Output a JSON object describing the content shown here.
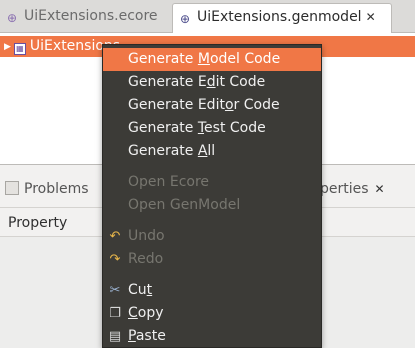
{
  "tabs": [
    {
      "label": "UiExtensions.ecore",
      "icon": "ecore-file-icon",
      "active": false
    },
    {
      "label": "UiExtensions.genmodel",
      "icon": "genmodel-file-icon",
      "active": true,
      "close": "✕"
    }
  ],
  "tree": {
    "root_label": "UiExtensions",
    "expand_glyph": "▶"
  },
  "panel": {
    "problems_label": "Problems",
    "properties_label": "perties",
    "properties_close": "✕",
    "property_column": "Property"
  },
  "menu": {
    "items": [
      {
        "pre": "Generate ",
        "ul": "M",
        "post": "odel Code",
        "enabled": true,
        "selected": true
      },
      {
        "pre": "Generate E",
        "ul": "d",
        "post": "it Code",
        "enabled": true
      },
      {
        "pre": "Generate Edit",
        "ul": "o",
        "post": "r Code",
        "enabled": true
      },
      {
        "pre": "Generate ",
        "ul": "T",
        "post": "est Code",
        "enabled": true
      },
      {
        "pre": "Generate ",
        "ul": "A",
        "post": "ll",
        "enabled": true
      },
      {
        "label": "Open Ecore",
        "enabled": false
      },
      {
        "label": "Open GenModel",
        "enabled": false
      },
      {
        "label": "Undo",
        "enabled": false,
        "icon": "undo-icon"
      },
      {
        "label": "Redo",
        "enabled": false,
        "icon": "redo-icon"
      },
      {
        "pre": "Cu",
        "ul": "t",
        "post": "",
        "enabled": true,
        "icon": "cut-icon"
      },
      {
        "pre": "",
        "ul": "C",
        "post": "opy",
        "enabled": true,
        "icon": "copy-icon"
      },
      {
        "pre": "",
        "ul": "P",
        "post": "aste",
        "enabled": true,
        "icon": "paste-icon"
      }
    ]
  },
  "colors": {
    "accent": "#f07746",
    "menu_bg": "#3c3b37"
  }
}
